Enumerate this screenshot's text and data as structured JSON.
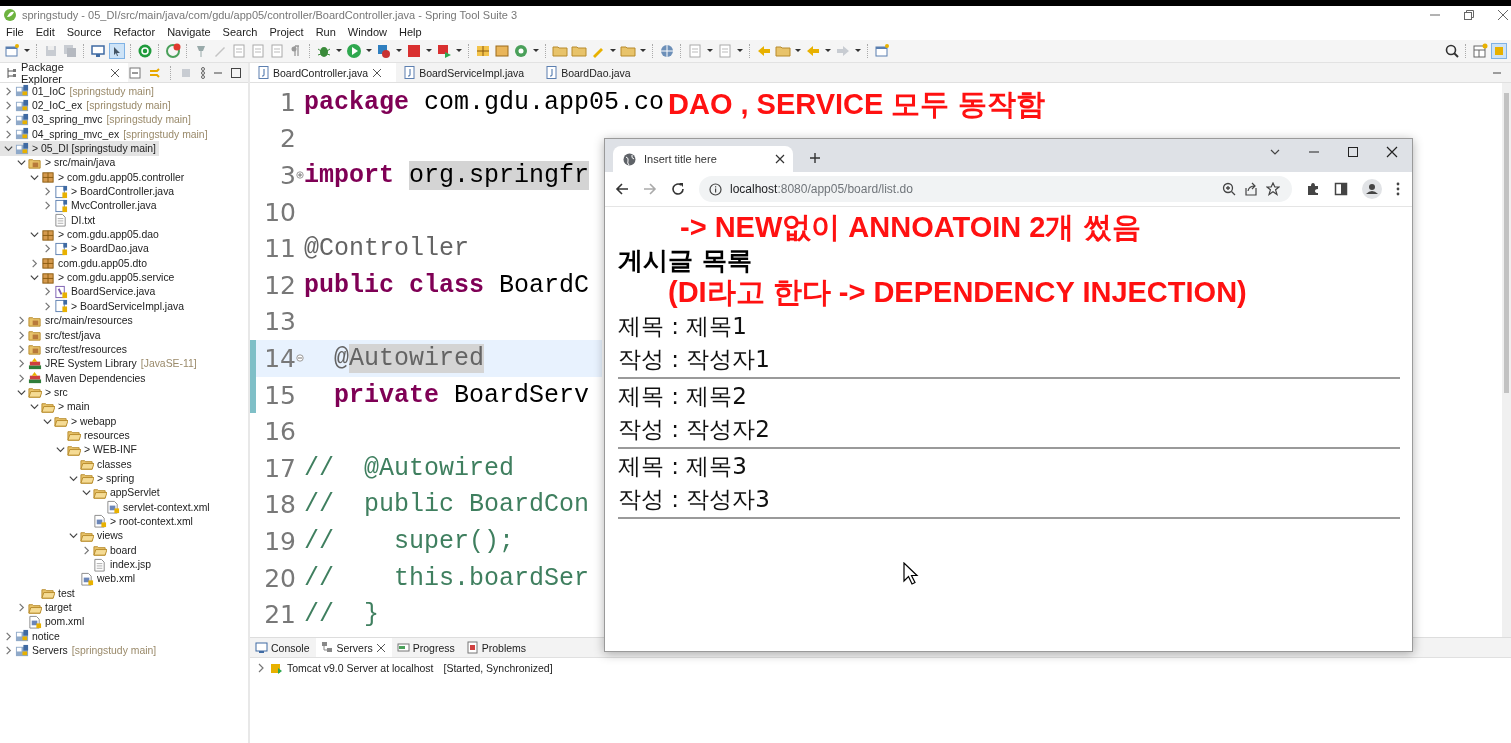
{
  "ide": {
    "title": "springstudy - 05_DI/src/main/java/com/gdu/app05/controller/BoardController.java - Spring Tool Suite 3",
    "menu": [
      "File",
      "Edit",
      "Source",
      "Refactor",
      "Navigate",
      "Search",
      "Project",
      "Run",
      "Window",
      "Help"
    ],
    "package_explorer": {
      "title": "Package Explorer",
      "tree": [
        {
          "label": "01_IoC",
          "decoration": "[springstudy main]",
          "kind": "project",
          "expanded": false,
          "selected": false
        },
        {
          "label": "02_IoC_ex",
          "decoration": "[springstudy main]",
          "kind": "project",
          "expanded": false,
          "selected": false
        },
        {
          "label": "03_spring_mvc",
          "decoration": "[springstudy main]",
          "kind": "project",
          "expanded": false,
          "selected": false
        },
        {
          "label": "04_spring_mvc_ex",
          "decoration": "[springstudy main]",
          "kind": "project",
          "expanded": false,
          "selected": false
        },
        {
          "label": "> 05_DI [springstudy main]",
          "kind": "project",
          "expanded": true,
          "selected": true,
          "children": [
            {
              "label": "> src/main/java",
              "kind": "srcfolder",
              "expanded": true,
              "selected": false,
              "children": [
                {
                  "label": "> com.gdu.app05.controller",
                  "kind": "package",
                  "expanded": true,
                  "selected": false,
                  "children": [
                    {
                      "label": "> BoardController.java",
                      "kind": "java",
                      "expanded": false,
                      "selected": false
                    },
                    {
                      "label": "MvcController.java",
                      "kind": "java",
                      "expanded": false,
                      "selected": false
                    },
                    {
                      "label": "DI.txt",
                      "kind": "text",
                      "selected": false
                    }
                  ]
                },
                {
                  "label": "> com.gdu.app05.dao",
                  "kind": "package",
                  "expanded": true,
                  "selected": false,
                  "children": [
                    {
                      "label": "> BoardDao.java",
                      "kind": "java",
                      "expanded": false,
                      "selected": false
                    }
                  ]
                },
                {
                  "label": "com.gdu.app05.dto",
                  "kind": "package",
                  "expanded": false,
                  "selected": false
                },
                {
                  "label": "> com.gdu.app05.service",
                  "kind": "package",
                  "expanded": true,
                  "selected": false,
                  "children": [
                    {
                      "label": "BoardService.java",
                      "kind": "interface",
                      "expanded": false,
                      "selected": false
                    },
                    {
                      "label": "> BoardServiceImpl.java",
                      "kind": "java",
                      "expanded": false,
                      "selected": false
                    }
                  ]
                }
              ]
            },
            {
              "label": "src/main/resources",
              "kind": "srcfolder",
              "expanded": false,
              "selected": false
            },
            {
              "label": "src/test/java",
              "kind": "srcfolder",
              "expanded": false,
              "selected": false
            },
            {
              "label": "src/test/resources",
              "kind": "srcfolder",
              "expanded": false,
              "selected": false
            },
            {
              "label": "JRE System Library",
              "decoration": "[JavaSE-11]",
              "kind": "library",
              "expanded": false,
              "selected": false
            },
            {
              "label": "Maven Dependencies",
              "kind": "library",
              "expanded": false,
              "selected": false
            },
            {
              "label": "> src",
              "kind": "folder",
              "expanded": true,
              "selected": false,
              "children": [
                {
                  "label": "> main",
                  "kind": "folder",
                  "expanded": true,
                  "selected": false,
                  "children": [
                    {
                      "label": "> webapp",
                      "kind": "folder",
                      "expanded": true,
                      "selected": false,
                      "children": [
                        {
                          "label": "resources",
                          "kind": "folder",
                          "selected": false
                        },
                        {
                          "label": "> WEB-INF",
                          "kind": "folder",
                          "expanded": true,
                          "selected": false,
                          "children": [
                            {
                              "label": "classes",
                              "kind": "folder",
                              "selected": false
                            },
                            {
                              "label": "> spring",
                              "kind": "folder",
                              "expanded": true,
                              "selected": false,
                              "children": [
                                {
                                  "label": "appServlet",
                                  "kind": "folder",
                                  "expanded": true,
                                  "selected": false,
                                  "children": [
                                    {
                                      "label": "servlet-context.xml",
                                      "kind": "xml",
                                      "selected": false
                                    }
                                  ]
                                },
                                {
                                  "label": "> root-context.xml",
                                  "kind": "xml",
                                  "selected": false
                                }
                              ]
                            },
                            {
                              "label": "views",
                              "kind": "folder",
                              "expanded": true,
                              "selected": false,
                              "children": [
                                {
                                  "label": "board",
                                  "kind": "folder",
                                  "expanded": false,
                                  "selected": false
                                },
                                {
                                  "label": "index.jsp",
                                  "kind": "text",
                                  "selected": false
                                }
                              ]
                            },
                            {
                              "label": "web.xml",
                              "kind": "xml",
                              "selected": false
                            }
                          ]
                        }
                      ]
                    }
                  ]
                },
                {
                  "label": "test",
                  "kind": "folder",
                  "selected": false
                }
              ]
            },
            {
              "label": "target",
              "kind": "folder",
              "expanded": false,
              "selected": false
            },
            {
              "label": "pom.xml",
              "kind": "xml",
              "selected": false
            }
          ]
        },
        {
          "label": "notice",
          "kind": "project",
          "expanded": false,
          "selected": false
        },
        {
          "label": "Servers",
          "decoration": "[springstudy main]",
          "kind": "project",
          "expanded": false,
          "selected": false
        }
      ]
    },
    "editor": {
      "tabs": [
        {
          "label": "BoardController.java",
          "selected": true
        },
        {
          "label": "BoardServiceImpl.java",
          "selected": false
        },
        {
          "label": "BoardDao.java",
          "selected": false
        }
      ],
      "lines": [
        {
          "number": "1",
          "segments": [
            {
              "kind": "keyword",
              "text": "package"
            },
            {
              "kind": "plain",
              "text": " com.gdu.app05.co"
            }
          ]
        },
        {
          "number": "2"
        },
        {
          "number": "3",
          "folded": true,
          "segments": [
            {
              "kind": "keyword",
              "text": "import "
            },
            {
              "kind": "marked",
              "text": "org.springfr"
            }
          ]
        },
        {
          "number": "10"
        },
        {
          "number": "11",
          "segments": [
            {
              "kind": "annotation",
              "text": "@Controller"
            }
          ]
        },
        {
          "number": "12",
          "segments": [
            {
              "kind": "keyword",
              "text": "public class"
            },
            {
              "kind": "plain",
              "text": " BoardC"
            }
          ]
        },
        {
          "number": "13"
        },
        {
          "number": "14",
          "folded": false,
          "current": true,
          "changed": true,
          "segments": [
            {
              "kind": "annotation",
              "text": "  @"
            },
            {
              "kind": "annotation_marked",
              "text": "Autowired"
            }
          ]
        },
        {
          "number": "15",
          "changed": true,
          "segments": [
            {
              "kind": "keyword",
              "text": "  private"
            },
            {
              "kind": "plain",
              "text": " BoardServ"
            }
          ]
        },
        {
          "number": "16"
        },
        {
          "number": "17",
          "segments": [
            {
              "kind": "comment",
              "text": "//  @Autowired"
            }
          ]
        },
        {
          "number": "18",
          "segments": [
            {
              "kind": "comment",
              "text": "//  public BoardCon"
            }
          ]
        },
        {
          "number": "19",
          "segments": [
            {
              "kind": "comment",
              "text": "//    super();"
            }
          ]
        },
        {
          "number": "20",
          "segments": [
            {
              "kind": "comment",
              "text": "//    this.boardSer"
            }
          ]
        },
        {
          "number": "21",
          "segments": [
            {
              "kind": "comment",
              "text": "//  }"
            }
          ]
        }
      ]
    },
    "bottom_panel": {
      "tabs": [
        {
          "label": "Console",
          "selected": false
        },
        {
          "label": "Servers",
          "selected": true
        },
        {
          "label": "Progress",
          "selected": false
        },
        {
          "label": "Problems",
          "selected": false
        }
      ],
      "servers": [
        {
          "name": "Tomcat v9.0 Server at localhost",
          "status": "[Started, Synchronized]"
        }
      ]
    }
  },
  "browser": {
    "tab_title": "Insert title here",
    "back_enabled": true,
    "forward_enabled": false,
    "url_host": "localhost",
    "url_rest": ":8080/app05/board/list.do",
    "heading": "게시글 목록",
    "posts": [
      {
        "title": "제목 : 제목1",
        "author": "작성 : 작성자1"
      },
      {
        "title": "제목 : 제목2",
        "author": "작성 : 작성자2"
      },
      {
        "title": "제목 : 제목3",
        "author": "작성 : 작성자3"
      }
    ]
  },
  "annotations": [
    {
      "kind": "top",
      "text": "DAO , SERVICE 모두 동작함"
    },
    {
      "kind": "middle",
      "text": "-> NEW없이 ANNOATOIN 2개 썼음"
    },
    {
      "kind": "lower",
      "text": "(DI라고 한다 -> DEPENDENCY INJECTION)"
    }
  ]
}
